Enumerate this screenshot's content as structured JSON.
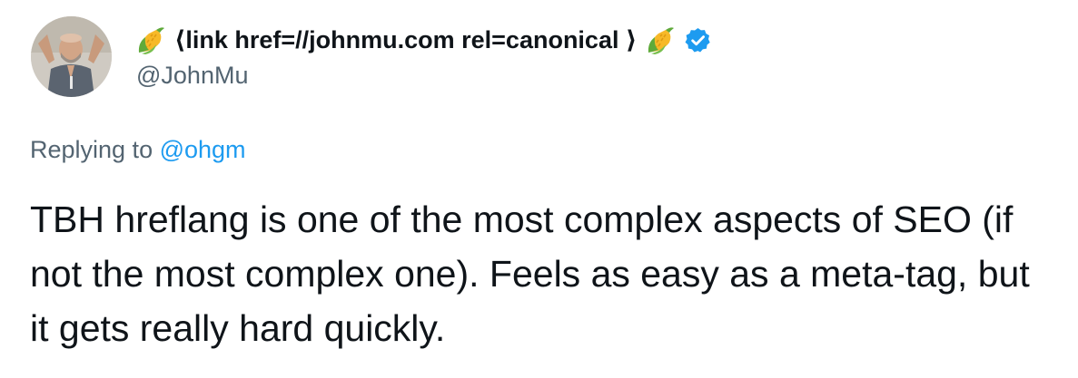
{
  "author": {
    "avatar_icon": "avatar-photo",
    "leading_emoji": "corn-emoji",
    "display_name": "⟨link href=//johnmu.com rel=canonical ⟩",
    "trailing_emoji": "corn-emoji",
    "verified_icon": "verified-badge-icon",
    "handle": "@JohnMu"
  },
  "reply": {
    "prefix": "Replying to ",
    "mention": "@ohgm"
  },
  "tweet": {
    "text": "TBH hreflang is one of the most complex aspects of SEO (if not the most complex one). Feels as easy as a meta-tag, but it gets really hard quickly."
  },
  "colors": {
    "text_primary": "#0f1419",
    "text_secondary": "#536471",
    "link": "#1d9bf0",
    "verified": "#1d9bf0"
  }
}
